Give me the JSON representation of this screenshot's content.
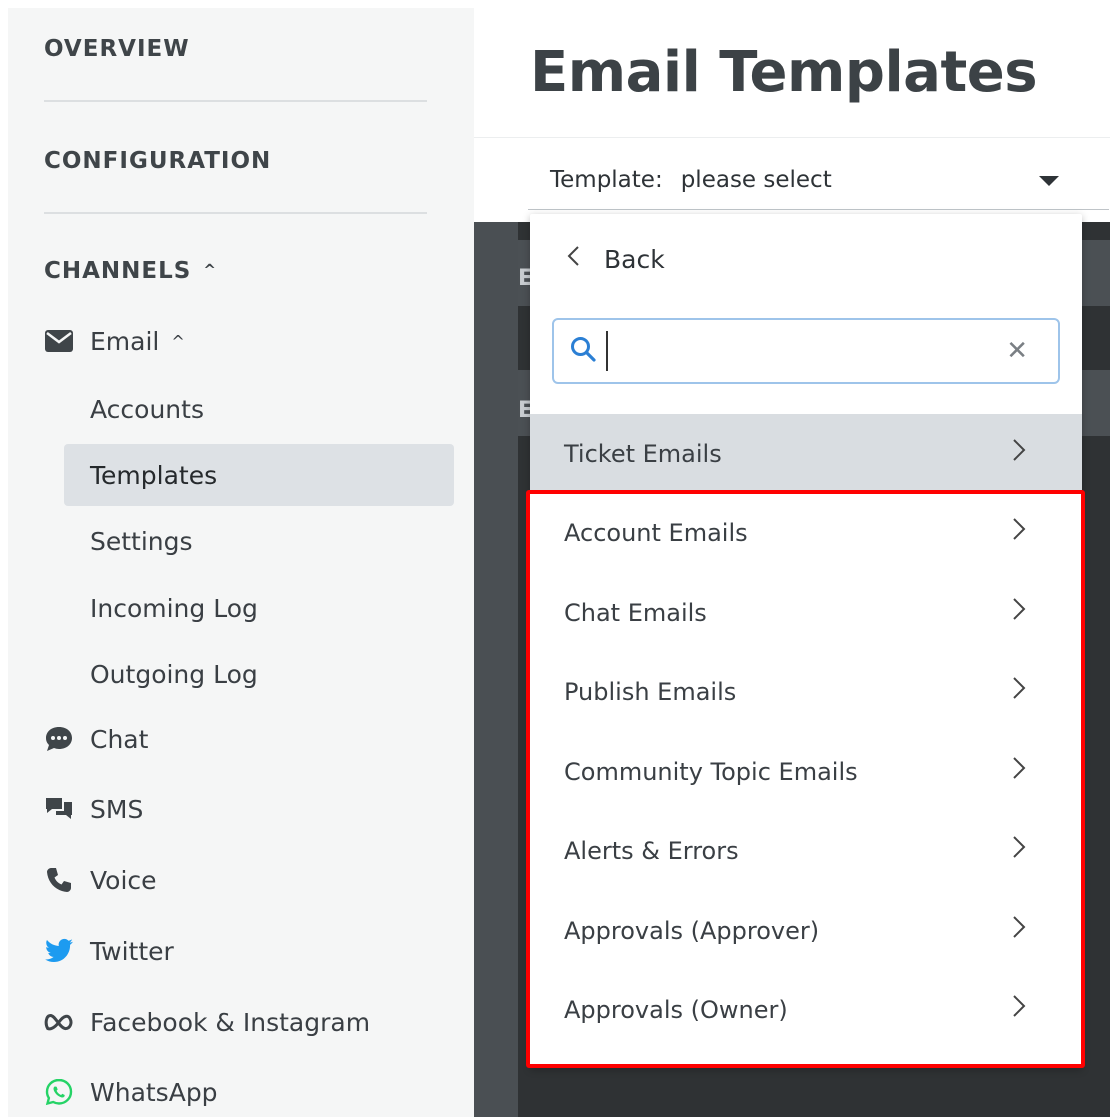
{
  "sidebar": {
    "overview": "OVERVIEW",
    "configuration": "CONFIGURATION",
    "channels": "CHANNELS",
    "email": {
      "label": "Email",
      "subitems": [
        "Accounts",
        "Templates",
        "Settings",
        "Incoming Log",
        "Outgoing Log"
      ],
      "active": "Templates"
    },
    "channel_items": [
      {
        "label": "Chat",
        "icon": "chat-bubble-icon"
      },
      {
        "label": "SMS",
        "icon": "sms-icon"
      },
      {
        "label": "Voice",
        "icon": "phone-icon"
      },
      {
        "label": "Twitter",
        "icon": "twitter-icon"
      },
      {
        "label": "Facebook & Instagram",
        "icon": "meta-icon"
      },
      {
        "label": "WhatsApp",
        "icon": "whatsapp-icon"
      }
    ]
  },
  "header": {
    "title": "Email Templates"
  },
  "selector": {
    "label": "Template:",
    "value": "please select"
  },
  "dropdown": {
    "back_label": "Back",
    "search_placeholder": "",
    "items": [
      "Ticket Emails",
      "Account Emails",
      "Chat Emails",
      "Publish Emails",
      "Community Topic Emails",
      "Alerts & Errors",
      "Approvals (Approver)",
      "Approvals (Owner)"
    ]
  },
  "background": {
    "letter": "E"
  },
  "colors": {
    "sidebar_bg": "#f5f6f6",
    "active_item_bg": "#dde1e5",
    "hover_item_bg": "#d9dde1",
    "search_border": "#9ec4ea",
    "search_icon": "#2b7fd4",
    "highlight": "#ff0000",
    "twitter": "#1d9bf0",
    "whatsapp": "#25d366"
  }
}
